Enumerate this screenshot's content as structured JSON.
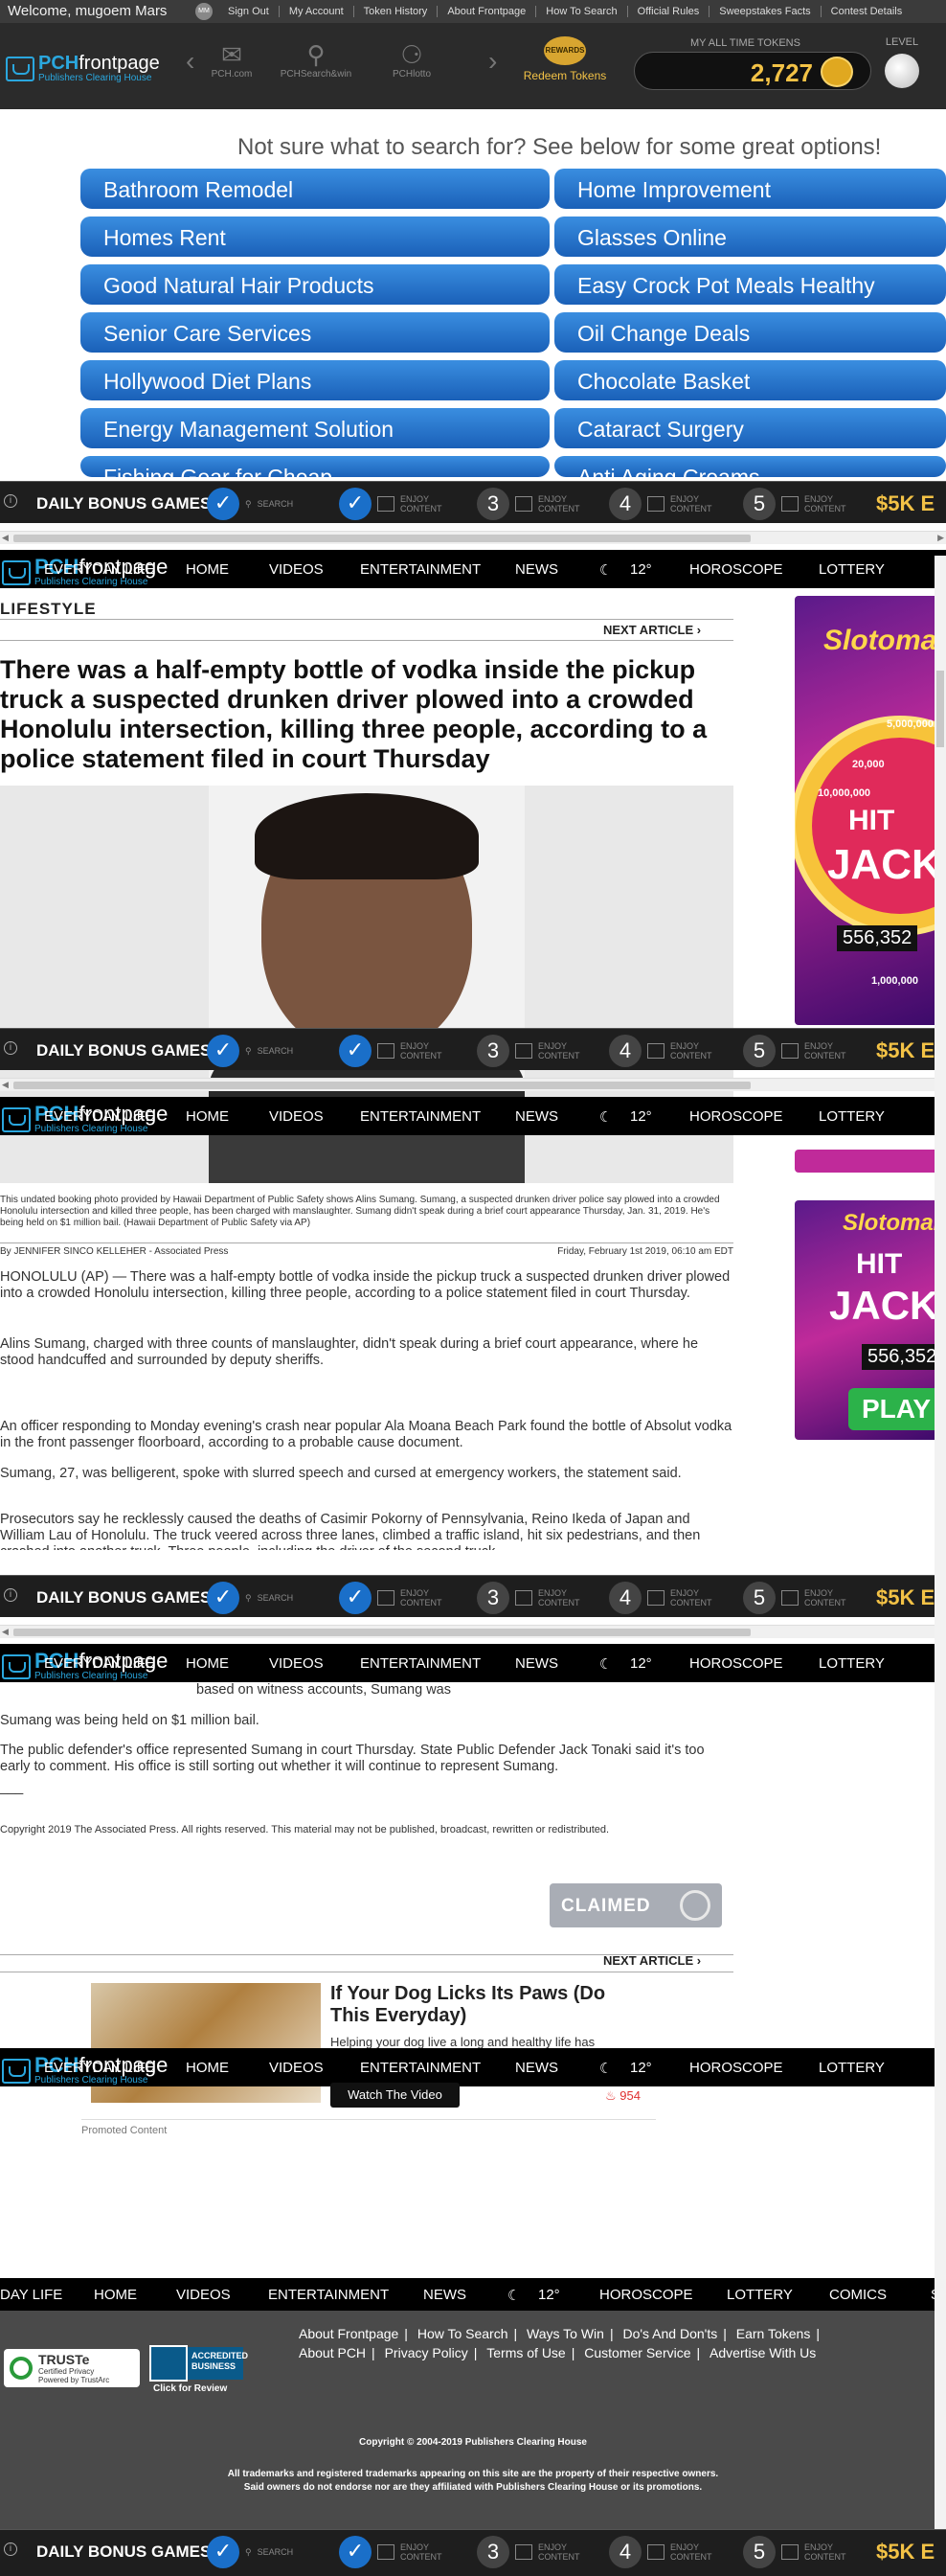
{
  "topbar": {
    "welcome": "Welcome, mugoem Mars",
    "avatar": "MM",
    "links": [
      "Sign Out",
      "My Account",
      "Token History",
      "About Frontpage",
      "How To Search",
      "Official Rules",
      "Sweepstakes Facts",
      "Contest Details"
    ]
  },
  "header": {
    "logo_brand": "PCH",
    "logo_frontpage": "frontpage",
    "logo_sub": "Publishers Clearing House",
    "nav": [
      {
        "icon": "envelope-icon",
        "label": "PCH.com"
      },
      {
        "icon": "search-win-icon",
        "label": "PCHSearch&win"
      },
      {
        "icon": "lotto-icon",
        "label": "PCHlotto"
      }
    ],
    "rewards_badge": "REWARDS",
    "rewards_label": "Redeem Tokens",
    "tokens_label": "MY ALL TIME TOKENS",
    "tokens_value": "2,727",
    "level_label": "LEVEL"
  },
  "suggestions": {
    "title": "Not sure what to search for? See below for some great options!",
    "items": [
      "Bathroom Remodel",
      "Home Improvement",
      "Homes Rent",
      "Glasses Online",
      "Good Natural Hair Products",
      "Easy Crock Pot Meals Healthy",
      "Senior Care Services",
      "Oil Change Deals",
      "Hollywood Diet Plans",
      "Chocolate Basket",
      "Energy Management Solution",
      "Cataract Surgery",
      "Fishing Gear for Cheap",
      "Anti Aging Creams"
    ]
  },
  "bonus": {
    "info": "i",
    "title": "DAILY BONUS GAMES",
    "check": "✓",
    "search_label": "SEARCH",
    "enjoy_label_1": "ENJOY",
    "enjoy_label_2": "CONTENT",
    "steps": [
      "3",
      "4",
      "5"
    ],
    "prize": "$5K E"
  },
  "nav": {
    "items": [
      "EVERYDAY LIFE",
      "HOME",
      "VIDEOS",
      "ENTERTAINMENT",
      "NEWS",
      "12°",
      "HOROSCOPE",
      "LOTTERY"
    ],
    "footer_items": [
      "DAY LIFE",
      "HOME",
      "VIDEOS",
      "ENTERTAINMENT",
      "NEWS",
      "12°",
      "HOROSCOPE",
      "LOTTERY",
      "COMICS",
      "S"
    ]
  },
  "article": {
    "section": "LIFESTYLE",
    "next_article": "NEXT ARTICLE ›",
    "headline": "There was a half-empty bottle of vodka inside the pickup truck a suspected drunken driver plowed into a crowded Honolulu intersection, killing three people, according to a police statement filed in court Thursday",
    "caption": "This undated booking photo provided by Hawaii Department of Public Safety shows Alins Sumang. Sumang, a suspected drunken driver police say plowed into a crowded Honolulu intersection and killed three people, has been charged with manslaughter. Sumang didn't speak during a brief court appearance Thursday, Jan. 31, 2019. He's being held on $1 million bail. (Hawaii Department of Public Safety via AP)",
    "byline": "By JENNIFER SINCO KELLEHER - Associated Press",
    "date": "Friday, February 1st 2019, 06:10 am EDT",
    "p1": "HONOLULU (AP) — There was a half-empty bottle of vodka inside the pickup truck a suspected drunken driver plowed into a crowded Honolulu intersection, killing three people, according to a police statement filed in court Thursday.",
    "p2": "Alins Sumang, charged with three counts of manslaughter, didn't speak during a brief court appearance, where he stood handcuffed and surrounded by deputy sheriffs.",
    "p3": "An officer responding to Monday evening's crash near popular Ala Moana Beach Park found the bottle of Absolut vodka in the front passenger floorboard, according to a probable cause document.",
    "p4": "Sumang, 27, was belligerent, spoke with slurred speech and cursed at emergency workers, the statement said.",
    "p5": "Prosecutors say he recklessly caused the deaths of Casimir Pokorny of Pennsylvania, Reino Ikeda of Japan and William Lau of Honolulu. The truck veered across three lanes, climbed a traffic island, hit six pedestrians, and then crashed into another truck. Three people, including the driver of the second truck,",
    "p6_tail": "based on witness accounts, Sumang was speeding, police said.",
    "p7": "Sumang was being held on $1 million bail.",
    "p8": "The public defender's office represented Sumang in court Thursday. State Public Defender Jack Tonaki said it's too early to comment. His office is still sorting out whether it will continue to represent Sumang.",
    "p9": "___",
    "copyright": "Copyright 2019 The Associated Press. All rights reserved. This material may not be published, broadcast, rewritten or redistributed.",
    "claimed": "CLAIMED"
  },
  "ads": {
    "slot_title": "Slotomania",
    "hit": "HIT",
    "jack": "JACK",
    "jackpot": "556,352",
    "play": "PLAY",
    "wheel_values": [
      "5,000,000",
      "20,000",
      "10,000,000",
      "1,000,000"
    ]
  },
  "promo": {
    "title": "If Your Dog Licks Its Paws (Do This Everyday)",
    "desc": "Helping your dog live a long and healthy life has",
    "watch": "Watch The Video",
    "count": "954",
    "promoted": "Promoted Content"
  },
  "footer": {
    "links_row1": [
      "About Frontpage",
      "How To Search",
      "Ways To Win",
      "Do's And Don'ts",
      "Earn Tokens"
    ],
    "links_row2": [
      "About PCH",
      "Privacy Policy",
      "Terms of Use",
      "Customer Service",
      "Advertise With Us"
    ],
    "truste": "TRUSTe",
    "truste_sub1": "Certified Privacy",
    "truste_sub2": "Powered by TrustArc",
    "bbb": "ACCREDITED BUSINESS",
    "bbb_click": "Click for Review",
    "copyright": "Copyright © 2004-2019 Publishers Clearing House",
    "legal1": "All trademarks and registered trademarks appearing on this site are the property of their respective owners.",
    "legal2": "Said owners do not endorse nor are they affiliated with Publishers Clearing House or its promotions."
  },
  "colors": {
    "accent": "#2aa7de",
    "gold": "#f3c246",
    "button_blue": "#1a60b8"
  }
}
